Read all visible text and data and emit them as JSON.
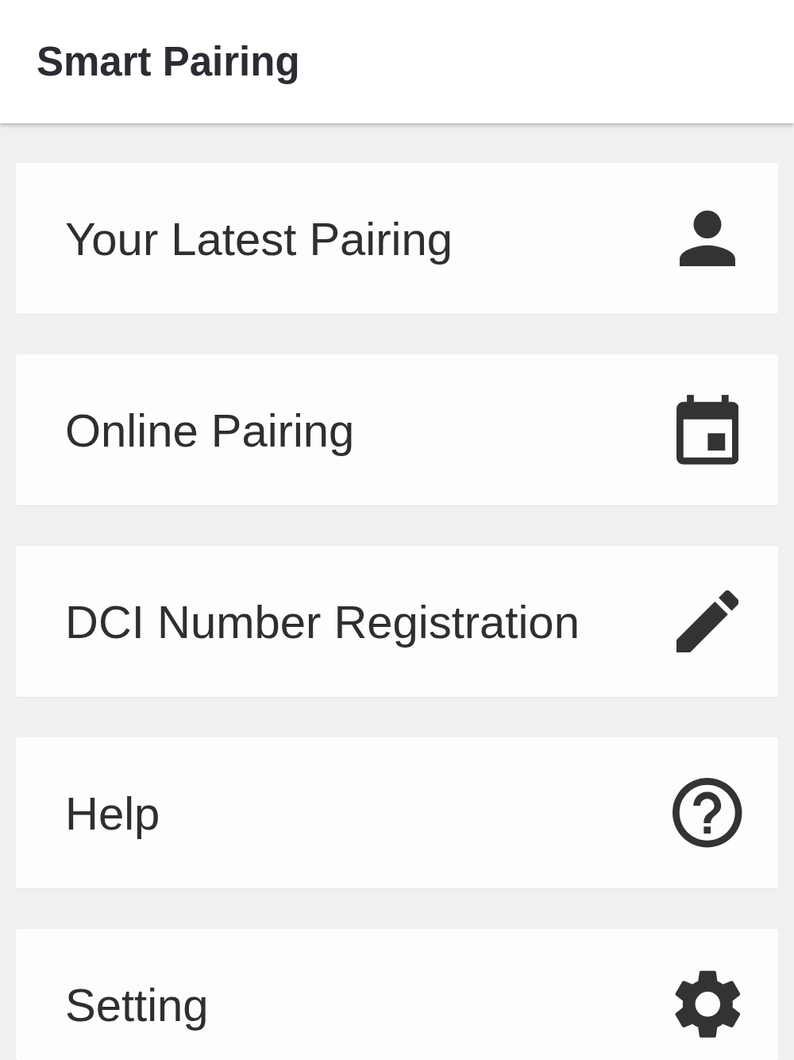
{
  "app_bar": {
    "title": "Smart Pairing"
  },
  "menu": [
    {
      "label": "Your Latest Pairing",
      "kind": "person"
    },
    {
      "label": "Online Pairing",
      "kind": "calendar"
    },
    {
      "label": "DCI Number Registration",
      "kind": "pencil"
    },
    {
      "label": "Help",
      "kind": "help"
    },
    {
      "label": "Setting",
      "kind": "gear"
    }
  ]
}
